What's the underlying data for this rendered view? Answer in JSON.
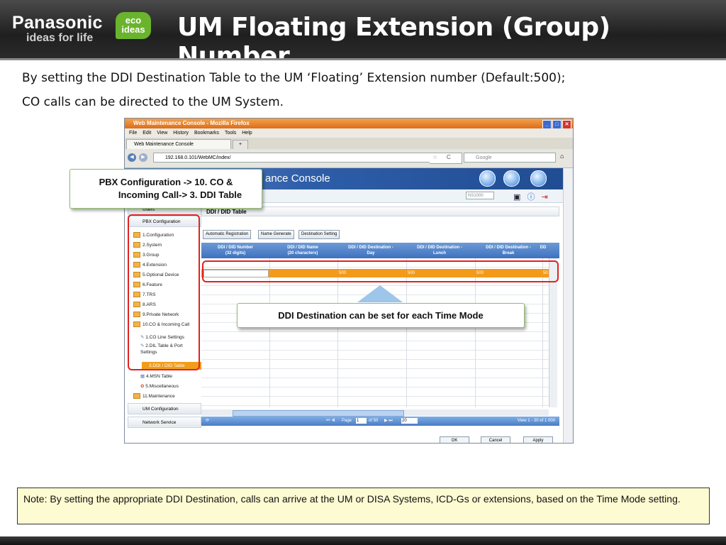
{
  "header": {
    "brand": "Panasonic",
    "tagline": "ideas for life",
    "eco_line1": "eco",
    "eco_line2": "ideas",
    "title": "UM Floating Extension (Group) Number"
  },
  "intro": {
    "line1": "By setting the DDI Destination Table to the UM ‘Floating’ Extension number (Default:500);",
    "line2": "CO calls can be directed to the UM System."
  },
  "browser": {
    "window_title": "Web Maintenance Console - Mozilla Firefox",
    "menu": [
      "File",
      "Edit",
      "View",
      "History",
      "Bookmarks",
      "Tools",
      "Help"
    ],
    "tab_label": "Web Maintenance Console",
    "new_tab": "+",
    "url": "192.168.0.101/WebMC/index/",
    "search_placeholder": "Google"
  },
  "app": {
    "banner_title": "ance Console",
    "site_select": "NS1000",
    "sidebar": {
      "users": "Users",
      "pbx": "PBX Configuration",
      "items": [
        "1.Configuration",
        "2.System",
        "3.Group",
        "4.Extension",
        "5.Optional Device",
        "6.Feature",
        "7.TRS",
        "8.ARS",
        "9.Private Network",
        "10.CO & Incoming Call"
      ],
      "sub_items": [
        "1.CO Line Settings",
        "2.DIL Table & Port Settings",
        "3.DDI / DID Table",
        "4.MSN Table",
        "5.Miscellaneous"
      ],
      "maintenance": "11.Maintenance",
      "um": "UM Configuration",
      "network": "Network Service"
    },
    "page_title": "DDI / DID Table",
    "buttons": [
      "Automatic Registration",
      "Name Generate",
      "Destination Setting"
    ],
    "columns": [
      {
        "l1": "DDI / DID Number",
        "l2": "(32 digits)"
      },
      {
        "l1": "DDI / DID Name",
        "l2": "(20 characters)"
      },
      {
        "l1": "DDI / DID Destination -",
        "l2": "Day"
      },
      {
        "l1": "DDI / DID Destination -",
        "l2": "Lunch"
      },
      {
        "l1": "DDI / DID Destination -",
        "l2": "Break"
      },
      {
        "l1": "DD",
        "l2": ""
      }
    ],
    "row_values": [
      "500",
      "500",
      "500",
      "50"
    ],
    "pager": {
      "page_label": "Page",
      "page_value": "1",
      "of_label": "of 50",
      "per_page": "20",
      "view": "View 1 - 20 of 1 000"
    },
    "footer_buttons": [
      "OK",
      "Cancel",
      "Apply"
    ]
  },
  "callouts": {
    "pbx_path_line1": "PBX Configuration -> 10. CO &",
    "pbx_path_line2": "Incoming Call-> 3. DDI Table",
    "ddi_note": "DDI Destination can be set for each Time Mode"
  },
  "note": "Note: By setting the appropriate DDI Destination, calls can arrive at the UM or DISA Systems, ICD-Gs or extensions, based on the Time Mode setting.",
  "colors": {
    "accent_orange": "#f39a1b",
    "callout_border": "#e0231f",
    "header_bg": "#2b2b2b",
    "eco_green": "#6ab42d"
  }
}
